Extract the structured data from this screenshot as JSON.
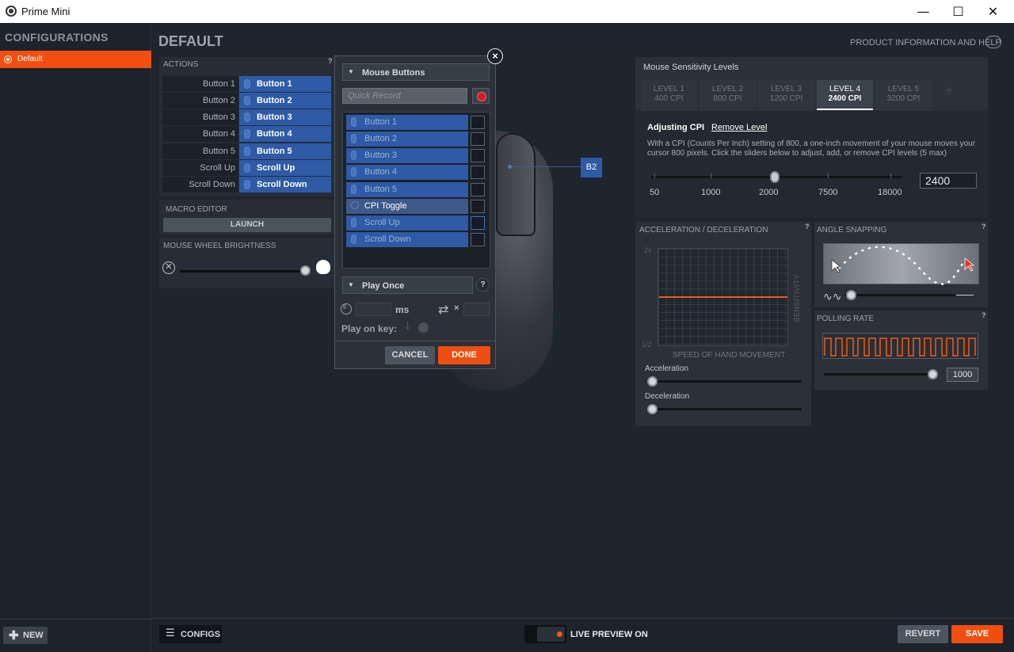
{
  "window": {
    "title": "Prime Mini",
    "minimize_label": "—",
    "maximize_label": "☐",
    "close_label": "✕"
  },
  "sidebar": {
    "header": "CONFIGURATIONS",
    "configs": [
      {
        "label": "Default",
        "active": true
      }
    ],
    "new_label": "NEW"
  },
  "main": {
    "title": "DEFAULT",
    "product_help": "PRODUCT INFORMATION AND HELP"
  },
  "actions": {
    "header": "ACTIONS",
    "help": "?",
    "rows": [
      {
        "name": "Button 1",
        "value": "Button 1"
      },
      {
        "name": "Button 2",
        "value": "Button 2"
      },
      {
        "name": "Button 3",
        "value": "Button 3"
      },
      {
        "name": "Button 4",
        "value": "Button 4"
      },
      {
        "name": "Button 5",
        "value": "Button 5"
      },
      {
        "name": "Scroll Up",
        "value": "Scroll Up"
      },
      {
        "name": "Scroll Down",
        "value": "Scroll Down"
      }
    ],
    "macro_editor": "MACRO EDITOR",
    "launch": "LAUNCH",
    "wheel_brightness": "MOUSE WHEEL BRIGHTNESS",
    "brightness_level": 1.0
  },
  "popup": {
    "category": "Mouse Buttons",
    "quick_record_placeholder": "Quick Record",
    "items": [
      {
        "label": "Button 1",
        "checked": false
      },
      {
        "label": "Button 2",
        "checked": false
      },
      {
        "label": "Button 3",
        "checked": false
      },
      {
        "label": "Button 4",
        "checked": false
      },
      {
        "label": "Button 5",
        "checked": false
      },
      {
        "label": "CPI Toggle",
        "checked": false
      },
      {
        "label": "Scroll Up",
        "checked": true
      },
      {
        "label": "Scroll Down",
        "checked": false
      }
    ],
    "play_mode": "Play Once",
    "play_help": "?",
    "ms_label": "ms",
    "times_label": "×",
    "play_on_key": "Play on key:",
    "cancel": "CANCEL",
    "done": "DONE",
    "close": "×"
  },
  "mouse_callout": "B2",
  "sensitivity": {
    "header": "Mouse Sensitivity Levels",
    "levels": [
      {
        "name": "LEVEL 1",
        "cpi": "400 CPI",
        "active": false
      },
      {
        "name": "LEVEL 2",
        "cpi": "800 CPI",
        "active": false
      },
      {
        "name": "LEVEL 3",
        "cpi": "1200 CPI",
        "active": false
      },
      {
        "name": "LEVEL 4",
        "cpi": "2400 CPI",
        "active": true
      },
      {
        "name": "LEVEL 5",
        "cpi": "3200 CPI",
        "active": false
      }
    ],
    "add_level": "+",
    "adjusting": "Adjusting CPI",
    "remove_level": "Remove Level",
    "description": "With a CPI (Counts Per Inch) setting of 800, a one-inch movement of your mouse moves your cursor 800 pixels. Click the sliders below to adjust, add, or remove CPI levels (5 max)",
    "scale_labels": [
      "50",
      "1000",
      "2000",
      "7500",
      "18000"
    ],
    "value": "2400"
  },
  "accel": {
    "header": "ACCELERATION / DECELERATION",
    "help": "?",
    "y_top": "2x",
    "y_bottom": "1/2",
    "y_label": "SENSITIVITY",
    "x_label": "SPEED OF HAND MOVEMENT",
    "acceleration": "Acceleration",
    "deceleration": "Deceleration",
    "acceleration_level": 0.0,
    "deceleration_level": 0.0
  },
  "angle": {
    "header": "ANGLE SNAPPING",
    "help": "?",
    "level": 0.0
  },
  "polling": {
    "header": "POLLING RATE",
    "help": "?",
    "value": "1000"
  },
  "bottom": {
    "configs": "CONFIGS",
    "live_preview": "LIVE PREVIEW ON",
    "revert": "REVERT",
    "save": "SAVE"
  },
  "colors": {
    "accent": "#f04e11",
    "selection_blue": "#2e5aa6",
    "background": "#1f252d"
  }
}
